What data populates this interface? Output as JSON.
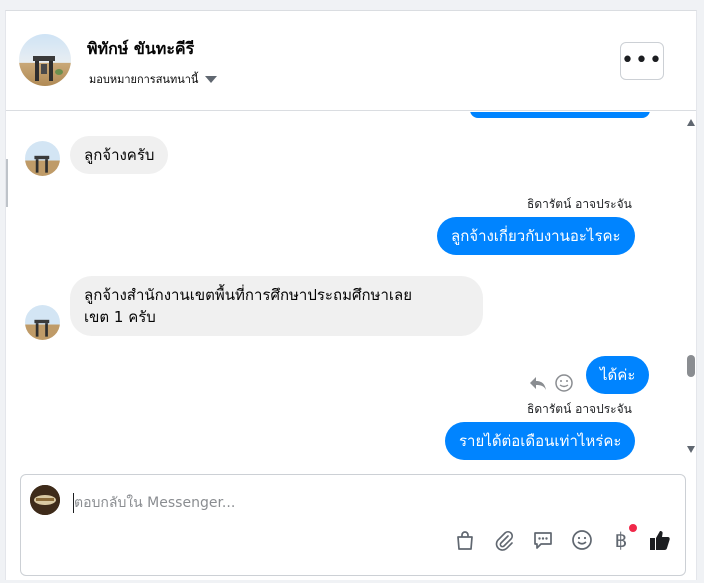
{
  "header": {
    "name": "พิทักษ์ ขันทะคีรี",
    "assign_label": "มอบหมายการสนทนานี้",
    "more_label": "•••"
  },
  "messages": [
    {
      "direction": "incoming",
      "text": "ลูกจ้างครับ"
    },
    {
      "direction": "outgoing",
      "sender": "ธิดารัตน์ อาจประจัน",
      "text": "ลูกจ้างเกี่ยวกับงานอะไรคะ"
    },
    {
      "direction": "incoming",
      "lines": [
        "ลูกจ้างสำนักงานเขตพื้นที่การศึกษาประถมศึกษาเลย",
        "เขต 1 ครับ"
      ]
    },
    {
      "direction": "outgoing",
      "text": "ได้ค่ะ"
    },
    {
      "direction": "outgoing",
      "sender": "ธิดารัตน์ อาจประจัน",
      "text": "รายได้ต่อเดือนเท่าไหร่คะ"
    }
  ],
  "composer": {
    "placeholder": "ตอบกลับใน Messenger..."
  },
  "toolbar": {
    "icons": [
      "shopping-bag-icon",
      "paperclip-icon",
      "saved-reply-icon",
      "emoji-icon",
      "baht-payment-icon",
      "thumbs-up-icon"
    ],
    "baht_symbol": "฿",
    "notification_color": "#f02849"
  },
  "colors": {
    "outgoing_bubble": "#0084ff",
    "incoming_bubble": "#f0f0f0",
    "icon_gray": "#606770"
  }
}
